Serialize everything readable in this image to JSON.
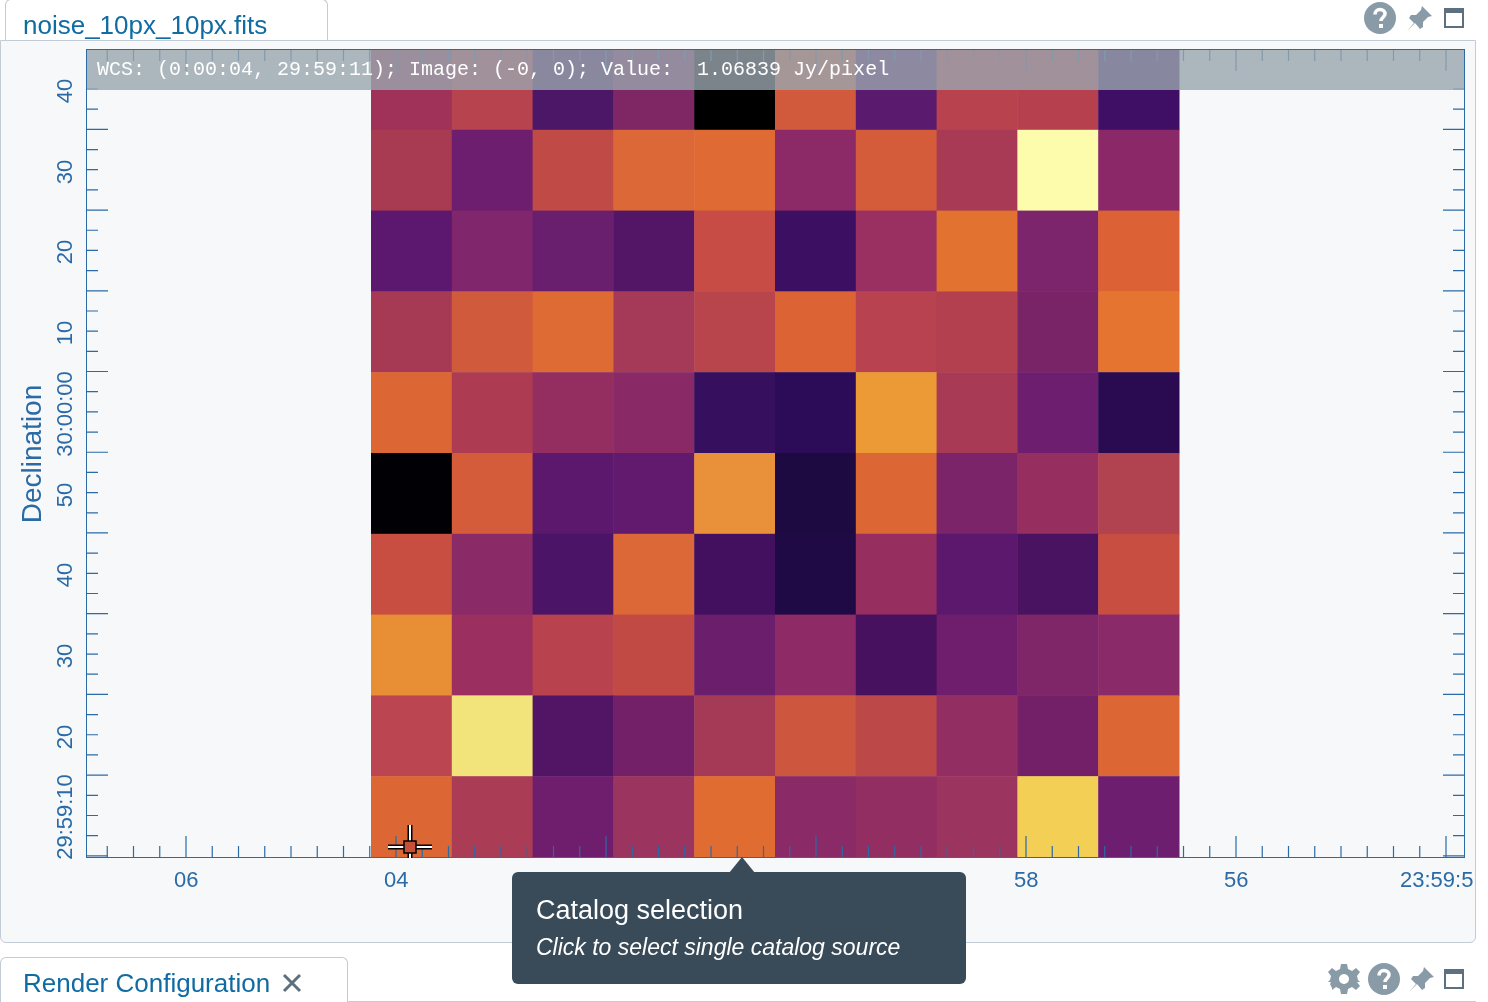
{
  "image_tab": {
    "label": "noise_10px_10px.fits",
    "selected": true
  },
  "cursor_info": "WCS: (0:00:04, 29:59:11); Image: (-0, 0); Value:  1.06839 Jy/pixel",
  "y_axis": {
    "title": "Declination",
    "ticks": [
      "40",
      "30",
      "20",
      "10",
      "30:00:00",
      "50",
      "40",
      "30",
      "20",
      "29:59:10"
    ]
  },
  "x_axis": {
    "ticks": [
      "06",
      "04",
      "58",
      "56",
      "23:59:5"
    ]
  },
  "tooltip": {
    "title": "Catalog selection",
    "text": "Click to select single catalog source"
  },
  "bottom_tab": {
    "label": "Render Configuration",
    "selected": true
  }
}
